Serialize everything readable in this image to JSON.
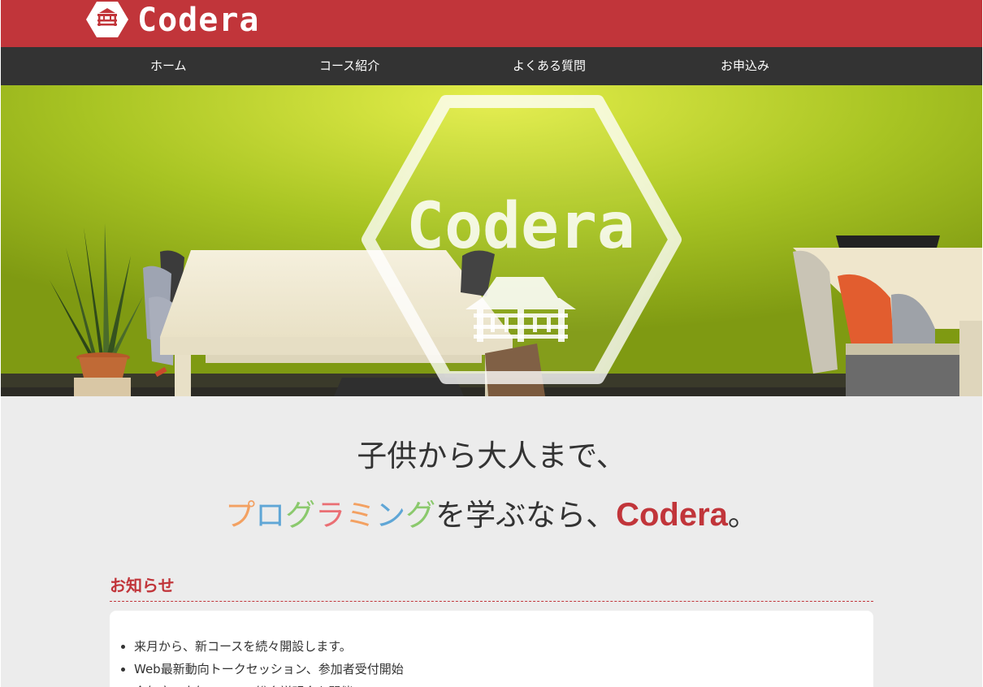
{
  "brand": {
    "name": "Codera",
    "hero_logo_text": "Codera"
  },
  "nav": {
    "items": [
      {
        "label": "ホーム"
      },
      {
        "label": "コース紹介"
      },
      {
        "label": "よくある質問"
      },
      {
        "label": "お申込み"
      }
    ]
  },
  "tagline": {
    "line1": "子供から大人まで、",
    "programming_chars": [
      {
        "char": "プ",
        "color": "#f3a162"
      },
      {
        "char": "ロ",
        "color": "#5fa6d6"
      },
      {
        "char": "グ",
        "color": "#8bc96d"
      },
      {
        "char": "ラ",
        "color": "#ea6f74"
      },
      {
        "char": "ミ",
        "color": "#f3a162"
      },
      {
        "char": "ン",
        "color": "#5fa6d6"
      },
      {
        "char": "グ",
        "color": "#8bc96d"
      }
    ],
    "middle": "を学ぶなら、",
    "brand": "Codera",
    "end": "。"
  },
  "news": {
    "title": "お知らせ",
    "items": [
      "来月から、新コースを続々開設します。",
      "Web最新動向トークセッション、参加者受付開始",
      "今年度の人気コースの総合説明会を開催"
    ]
  },
  "colors": {
    "brand_red": "#c1353a",
    "nav_dark": "#333333",
    "page_bg": "#ececec"
  }
}
